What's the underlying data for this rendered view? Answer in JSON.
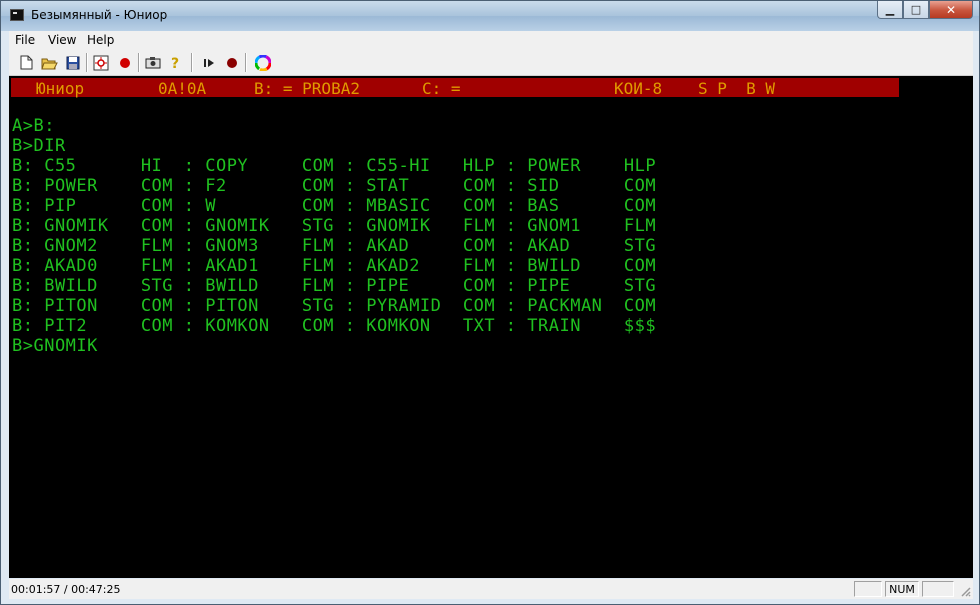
{
  "window": {
    "title": "Безымянный - Юниор",
    "minimize": "▁",
    "maximize": "□",
    "close": "✕"
  },
  "menu": [
    "File",
    "View",
    "Help"
  ],
  "toolbar": [
    "new-icon",
    "open-icon",
    "save-icon",
    "settings-icon",
    "record-icon",
    "camera-icon",
    "help-icon",
    "play-icon",
    "stop-record-icon",
    "palette-icon"
  ],
  "screen": {
    "status_strip": {
      "name": "Юниор",
      "addr": "0A!0A",
      "drive_b": "B: = PROBA2",
      "drive_c": "C: =",
      "code": "КОИ-8",
      "flags": "S P  B W"
    },
    "lines": [
      "A>B:",
      "B>DIR",
      "B: C55      HI  : COPY     COM : C55-HI   HLP : POWER    HLP",
      "B: POWER    COM : F2       COM : STAT     COM : SID      COM",
      "B: PIP      COM : W        COM : MBASIC   COM : BAS      COM",
      "B: GNOMIK   COM : GNOMIK   STG : GNOMIK   FLM : GNOM1    FLM",
      "B: GNOM2    FLM : GNOM3    FLM : AKAD     COM : AKAD     STG",
      "B: AKAD0    FLM : AKAD1    FLM : AKAD2    FLM : BWILD    COM",
      "B: BWILD    STG : BWILD    FLM : PIPE     COM : PIPE     STG",
      "B: PITON    COM : PITON    STG : PYRAMID  COM : PACKMAN  COM",
      "B: PIT2     COM : KOMKON   COM : KOMKON   TXT : TRAIN    $$$",
      "B>GNOMIK"
    ]
  },
  "statusbar": {
    "time": "00:01:57 / 00:47:25",
    "num": "NUM"
  },
  "colors": {
    "terminal_bg": "#000000",
    "terminal_fg": "#20c020",
    "strip_bg": "#a00000",
    "strip_fg": "#e09a00"
  }
}
